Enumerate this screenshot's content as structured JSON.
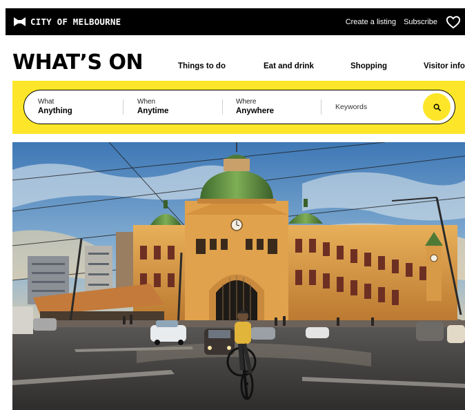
{
  "topbar": {
    "brand": "CITY OF MELBOURNE",
    "links": [
      "Create a listing",
      "Subscribe"
    ],
    "favorite_icon": "heart-icon"
  },
  "header": {
    "title": "WHAT’S ON",
    "nav": [
      "Things to do",
      "Eat and drink",
      "Shopping",
      "Visitor info"
    ]
  },
  "search": {
    "what_label": "What",
    "what_value": "Anything",
    "when_label": "When",
    "when_value": "Anytime",
    "where_label": "Where",
    "where_value": "Anywhere",
    "keywords_placeholder": "Keywords",
    "icon": "search-icon"
  },
  "colors": {
    "topbar": "#000000",
    "accent_yellow": "#fde629"
  },
  "hero": {
    "alt": "Flinders Street Station at sunset with a cyclist in the foreground"
  }
}
